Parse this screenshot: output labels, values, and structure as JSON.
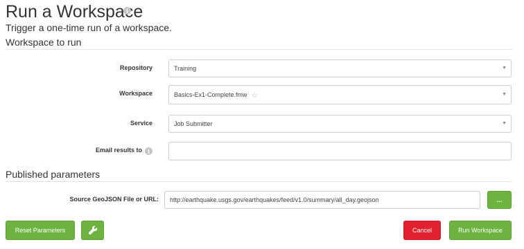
{
  "header": {
    "title": "Run a Workspace",
    "info_icon_glyph": "i",
    "subtitle": "Trigger a one-time run of a workspace."
  },
  "workspace_section": {
    "heading": "Workspace to run",
    "repository": {
      "label": "Repository",
      "value": "Training"
    },
    "workspace": {
      "label": "Workspace",
      "value": "Basics-Ex1-Complete.fmw",
      "star_icon": "☆"
    },
    "service": {
      "label": "Service",
      "value": "Job Submitter"
    },
    "email": {
      "label": "Email results to",
      "value": "",
      "info_icon_glyph": "i"
    }
  },
  "published_section": {
    "heading": "Published parameters",
    "source": {
      "label": "Source GeoJSON File or URL:",
      "value": "http://earthquake.usgs.gov/earthquakes/feed/v1.0/summary/all_day.geojson",
      "browse_label": "..."
    }
  },
  "footer": {
    "reset_label": "Reset Parameters",
    "tools_icon": "wrench-icon",
    "cancel_label": "Cancel",
    "run_label": "Run Workspace"
  },
  "colors": {
    "primary_green": "#6cb33f",
    "danger_red": "#e3202e",
    "input_border": "#cccccc"
  }
}
